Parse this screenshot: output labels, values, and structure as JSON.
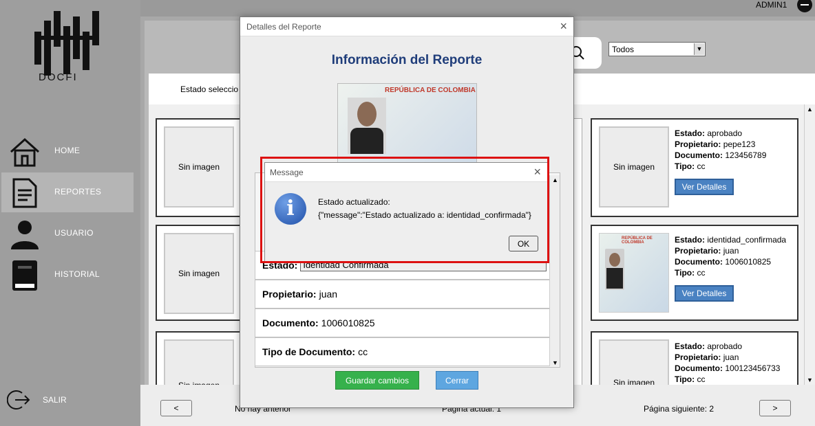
{
  "app": {
    "name": "DOCFI",
    "user": "ADMIN1"
  },
  "nav": [
    {
      "label": "HOME",
      "icon": "home-icon"
    },
    {
      "label": "REPORTES",
      "icon": "document-icon"
    },
    {
      "label": "USUARIO",
      "icon": "user-icon"
    },
    {
      "label": "HISTORIAL",
      "icon": "book-icon"
    }
  ],
  "logout": {
    "label": "SALIR"
  },
  "filter": {
    "select_value": "Todos",
    "status_label": "Estado seleccio"
  },
  "cards_right": [
    {
      "image": "Sin imagen",
      "estado": "aprobado",
      "propietario": "pepe123",
      "documento": "123456789",
      "tipo": "cc",
      "button": "Ver Detalles"
    },
    {
      "image": "",
      "estado": "identidad_confirmada",
      "propietario": "juan",
      "documento": "1006010825",
      "tipo": "cc",
      "button": "Ver Detalles"
    },
    {
      "image": "Sin imagen",
      "estado": "aprobado",
      "propietario": "juan",
      "documento": "100123456733",
      "tipo": "cc"
    }
  ],
  "cards_left": [
    {
      "image": "Sin imagen"
    },
    {
      "image": "Sin imagen"
    },
    {
      "image": "Sin imagen"
    }
  ],
  "labels": {
    "estado": "Estado:",
    "propietario": "Propietario:",
    "documento": "Documento:",
    "tipo": "Tipo:"
  },
  "pagination": {
    "prev": "<",
    "next": ">",
    "prev_text": "No hay anterior",
    "current": "Página actual: 1",
    "next_text": "Página siguiente: 2"
  },
  "dialog": {
    "title": "Detalles del Reporte",
    "heading": "Información del Reporte",
    "id_card": {
      "country": "REPÚBLICA DE COLOMBIA"
    },
    "estado_label": "Estado:",
    "estado_value": "Identidad Confirmada",
    "propietario_label": "Propietario:",
    "propietario_value": "juan",
    "documento_label": "Documento:",
    "documento_value": "1006010825",
    "tipo_label": "Tipo de Documento:",
    "tipo_value": "cc",
    "save": "Guardar cambios",
    "close": "Cerrar"
  },
  "message": {
    "title": "Message",
    "line1": "Estado actualizado:",
    "line2": "{\"message\":\"Estado actualizado a: identidad_confirmada\"}",
    "ok": "OK"
  },
  "colors": {
    "accent": "#4a82c2",
    "save": "#36b14c",
    "highlight": "#dd1111",
    "heading": "#1f3d7a"
  }
}
